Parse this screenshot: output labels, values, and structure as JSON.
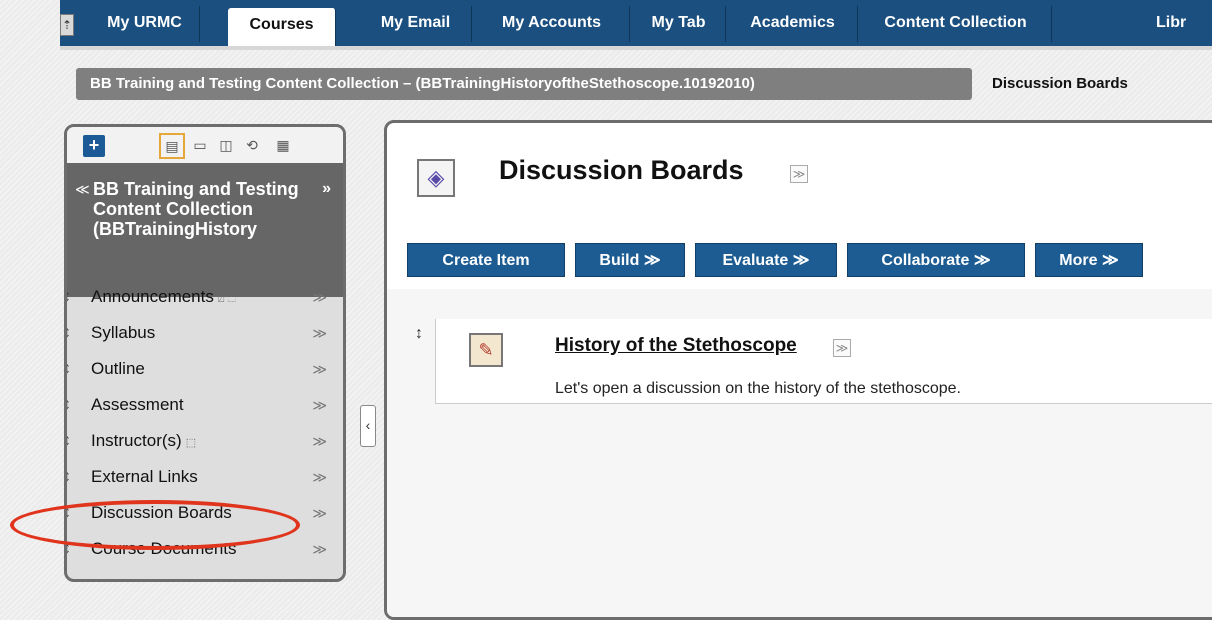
{
  "tabs": {
    "toggle_glyph": "⇡",
    "items": [
      {
        "label": "My URMC"
      },
      {
        "label": "Courses",
        "active": true
      },
      {
        "label": "My Email"
      },
      {
        "label": "My Accounts"
      },
      {
        "label": "My Tab"
      },
      {
        "label": "Academics"
      },
      {
        "label": "Content Collection"
      },
      {
        "label": "Libr"
      }
    ]
  },
  "breadcrumb": {
    "course": "BB Training and Testing Content Collection – (BBTrainingHistoryoftheStethoscope.10192010)",
    "current": "Discussion Boards"
  },
  "course_menu": {
    "add_glyph": "+",
    "toolbar_icons": [
      "list-view-icon",
      "folder-view-icon",
      "window-icon",
      "refresh-icon",
      "details-icon"
    ],
    "title": "BB Training and Testing Content Collection (BBTrainingHistory",
    "collapse_glyph": "»",
    "up_glyph": "»",
    "items": [
      {
        "label": "Announcements",
        "badges": "⍁ ⬚"
      },
      {
        "label": "Syllabus",
        "badges": ""
      },
      {
        "label": "Outline",
        "badges": ""
      },
      {
        "label": "Assessment",
        "badges": ""
      },
      {
        "label": "Instructor(s)",
        "badges": "⬚"
      },
      {
        "label": "External Links",
        "badges": ""
      },
      {
        "label": "Discussion Boards",
        "badges": "",
        "highlighted": true
      },
      {
        "label": "Course Documents",
        "badges": ""
      }
    ],
    "chevron_glyph": "≫",
    "drag_glyph": "↕"
  },
  "page": {
    "title": "Discussion Boards",
    "menu_glyph": "≫",
    "actions": [
      {
        "label": "Create Item"
      },
      {
        "label": "Build ≫"
      },
      {
        "label": "Evaluate ≫"
      },
      {
        "label": "Collaborate ≫"
      },
      {
        "label": "More ≫"
      }
    ],
    "item": {
      "title": "History of the Stethoscope",
      "description": "Let's open a discussion on the history of the stethoscope."
    }
  },
  "colors": {
    "tab_bar": "#1a4f7f",
    "action_button": "#1c5c93",
    "highlight": "#e0341c"
  }
}
